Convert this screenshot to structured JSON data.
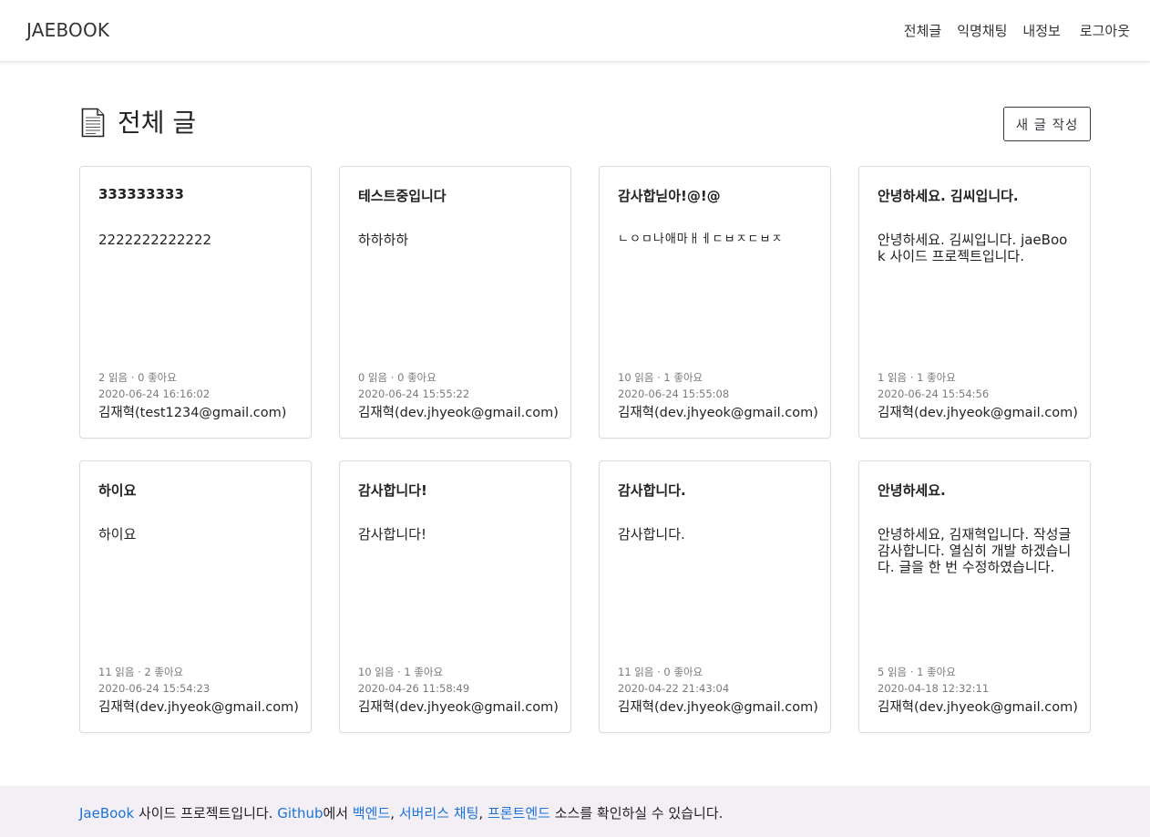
{
  "navbar": {
    "brand": "JAEBOOK",
    "links": [
      "전체글",
      "익명채팅",
      "내정보",
      "로그아웃"
    ]
  },
  "header": {
    "title": "전체 글",
    "new_post_label": "새 글 작성"
  },
  "cards": [
    {
      "title": "333333333",
      "body": "2222222222222",
      "stats": "2 읽음 · 0 좋아요",
      "date": "2020-06-24 16:16:02",
      "author": "김재혁(test1234@gmail.com)"
    },
    {
      "title": "테스트중입니다",
      "body": "하하하하",
      "stats": "0 읽음 · 0 좋아요",
      "date": "2020-06-24 15:55:22",
      "author": "김재혁(dev.jhyeok@gmail.com)"
    },
    {
      "title": "감사합닏아!@!@",
      "body": "ㄴㅇㅁ나애마ㅐㅔㄷㅂㅈㄷㅂㅈ",
      "stats": "10 읽음 · 1 좋아요",
      "date": "2020-06-24 15:55:08",
      "author": "김재혁(dev.jhyeok@gmail.com)"
    },
    {
      "title": "안녕하세요. 김씨입니다.",
      "body": "안녕하세요. 김씨입니다. jaeBook 사이드 프로젝트입니다.",
      "stats": "1 읽음 · 1 좋아요",
      "date": "2020-06-24 15:54:56",
      "author": "김재혁(dev.jhyeok@gmail.com)"
    },
    {
      "title": "하이요",
      "body": "하이요",
      "stats": "11 읽음 · 2 좋아요",
      "date": "2020-06-24 15:54:23",
      "author": "김재혁(dev.jhyeok@gmail.com)"
    },
    {
      "title": "감사합니다!",
      "body": "감사합니다!",
      "stats": "10 읽음 · 1 좋아요",
      "date": "2020-04-26 11:58:49",
      "author": "김재혁(dev.jhyeok@gmail.com)"
    },
    {
      "title": "감사합니다.",
      "body": "감사합니다.",
      "stats": "11 읽음 · 0 좋아요",
      "date": "2020-04-22 21:43:04",
      "author": "김재혁(dev.jhyeok@gmail.com)"
    },
    {
      "title": "안녕하세요.",
      "body": "안녕하세요, 김재혁입니다. 작성글 감사합니다. 열심히 개발 하겠습니다. 글을 한 번 수정하였습니다.",
      "stats": "5 읽음 · 1 좋아요",
      "date": "2020-04-18 12:32:11",
      "author": "김재혁(dev.jhyeok@gmail.com)"
    }
  ],
  "footer": {
    "project_link": "JaeBook",
    "text_1": " 사이드 프로젝트입니다. ",
    "github_link": "Github",
    "text_2": "에서 ",
    "backend_link": "백엔드",
    "sep_1": ", ",
    "chat_link": "서버리스 채팅",
    "sep_2": ", ",
    "frontend_link": "프론트엔드",
    "text_3": " 소스를 확인하실 수 있습니다."
  },
  "colors": {
    "link": "#1a73d9",
    "footer_bg": "#f4eff5",
    "meta_text": "#7a7a7a"
  }
}
